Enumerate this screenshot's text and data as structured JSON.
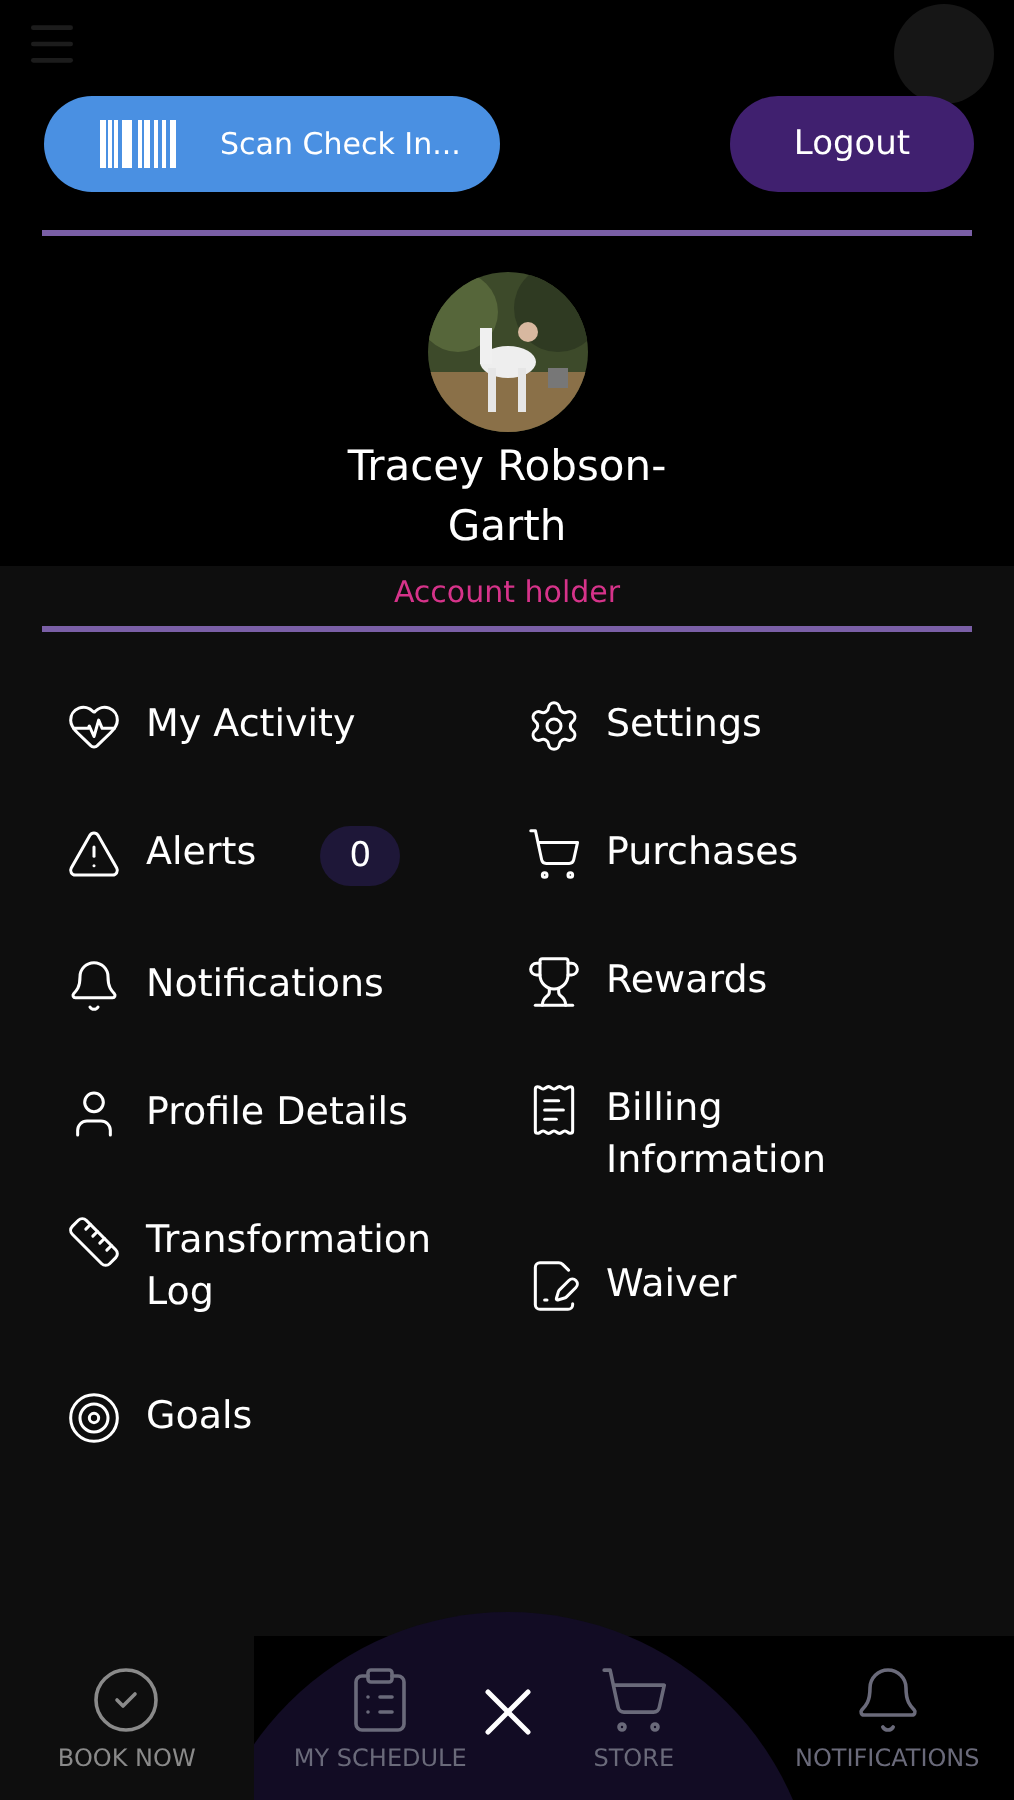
{
  "header": {
    "scan_button": "Scan Check In...",
    "logout_button": "Logout"
  },
  "profile": {
    "name": "Tracey Robson-Garth",
    "role": "Account holder"
  },
  "menu": {
    "left": [
      {
        "label": "My Activity"
      },
      {
        "label": "Alerts",
        "badge": "0"
      },
      {
        "label": "Notifications"
      },
      {
        "label": "Profile Details"
      },
      {
        "label": "Transformation Log"
      },
      {
        "label": "Goals"
      }
    ],
    "right": [
      {
        "label": "Settings"
      },
      {
        "label": "Purchases"
      },
      {
        "label": "Rewards"
      },
      {
        "label": "Billing Information"
      },
      {
        "label": "Waiver"
      }
    ]
  },
  "bottom_nav": [
    {
      "label": "BOOK NOW",
      "selected": true
    },
    {
      "label": "MY SCHEDULE",
      "selected": false
    },
    {
      "label": "STORE",
      "selected": false
    },
    {
      "label": "NOTIFICATIONS",
      "selected": false
    }
  ]
}
